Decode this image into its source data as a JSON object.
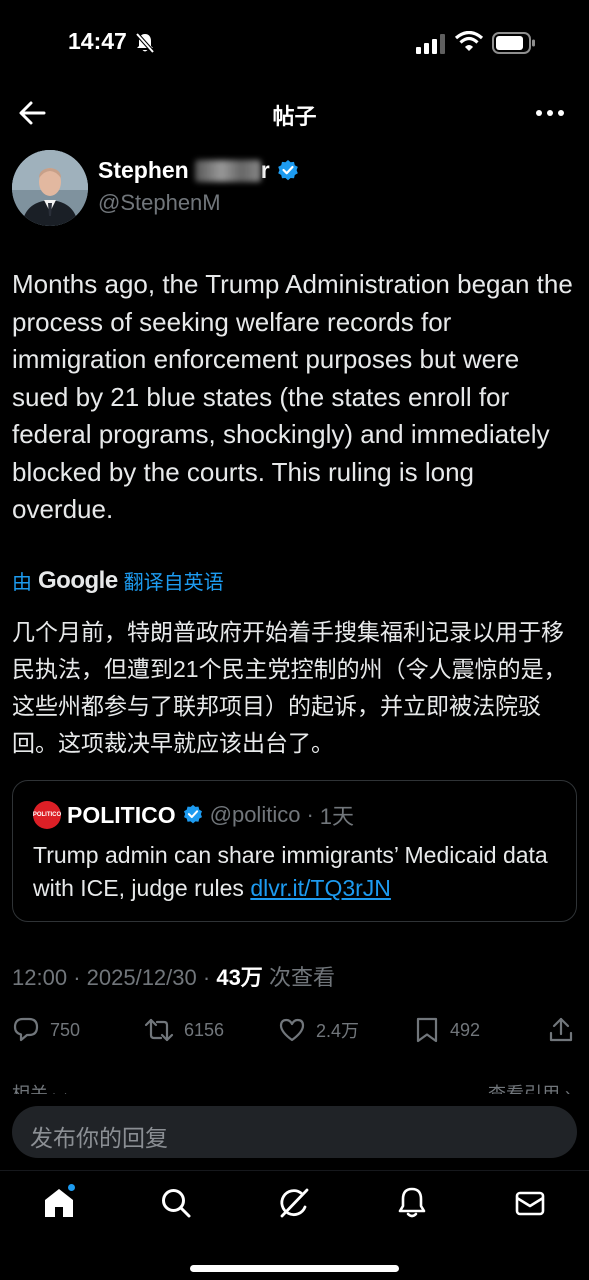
{
  "status_bar": {
    "time": "14:47"
  },
  "header": {
    "title": "帖子"
  },
  "author": {
    "name_visible": "Stephen",
    "name_trailing": "r",
    "handle": "@StephenM"
  },
  "tweet": {
    "text": "Months ago, the Trump Administration began the process of seeking welfare records for immigration enforcement purposes but were sued by 21 blue states (the states enroll for federal programs, shockingly) and immediately blocked by the courts. This ruling is long overdue.",
    "translate_prefix": "由",
    "translate_brand": "Google",
    "translate_suffix": "翻译自英语",
    "translated_text": "几个月前，特朗普政府开始着手搜集福利记录以用于移民执法，但遭到21个民主党控制的州（令人震惊的是，这些州都参与了联邦项目）的起诉，并立即被法院驳回。这项裁决早就应该出台了。"
  },
  "quote": {
    "logo_text": "POLITICO",
    "name": "POLITICO",
    "handle": "@politico",
    "separator": "·",
    "time": "1天",
    "text": "Trump admin can share immigrants’ Medicaid data with ICE, judge rules ",
    "link": "dlvr.it/TQ3rJN"
  },
  "meta": {
    "time": "12:00",
    "separator": "·",
    "date": "2025/12/30",
    "views_count": "43万",
    "views_label": "次查看"
  },
  "actions": {
    "replies": "750",
    "reposts": "6156",
    "likes": "2.4万",
    "bookmarks": "492"
  },
  "related": {
    "left": "相关",
    "right": "查看引用"
  },
  "reply": {
    "placeholder": "发布你的回复"
  },
  "colors": {
    "accent": "#1d9bf0",
    "background": "#000000",
    "muted": "#71767b",
    "politico_red": "#dc1f26"
  },
  "nav": {
    "items": [
      "home-icon",
      "search-icon",
      "grok-icon",
      "notifications-icon",
      "messages-icon"
    ]
  }
}
